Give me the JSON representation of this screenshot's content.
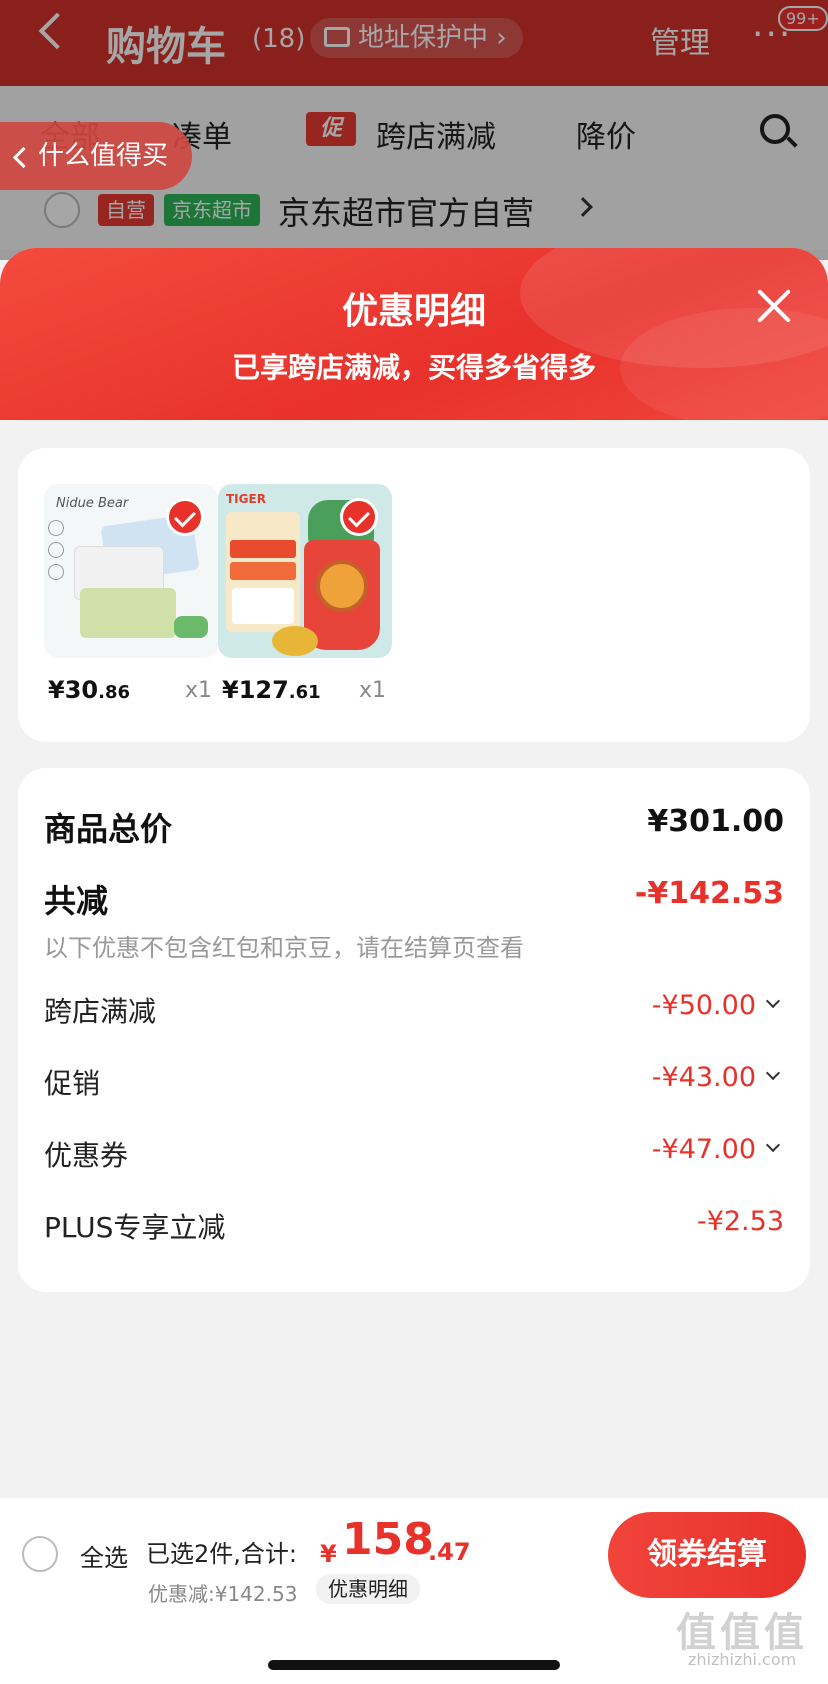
{
  "cart": {
    "title": "购物车",
    "count": "(18)",
    "address_protect": "地址保护中 ›",
    "manage": "管理",
    "more": "···",
    "badge": "99+",
    "tabs": [
      "全部",
      "凑单",
      "跨店满减",
      "降价"
    ],
    "promo_mark": "促",
    "float_tag": "什么值得买",
    "shop_tag_self": "自营",
    "shop_tag_market": "京东超市",
    "shop_name": "京东超市官方自营"
  },
  "sheet": {
    "title": "优惠明细",
    "subtitle": "已享跨店满减，买得多省得多"
  },
  "products": [
    {
      "brand": "Nidue Bear",
      "price_int": "¥30",
      "price_dec": ".86",
      "qty": "x1",
      "selected": true
    },
    {
      "brand": "TIGER",
      "price_int": "¥127",
      "price_dec": ".61",
      "qty": "x1",
      "selected": true
    }
  ],
  "summary": {
    "total_label": "商品总价",
    "total_value": "¥301.00",
    "less_label": "共减",
    "less_value": "-¥142.53",
    "note": "以下优惠不包含红包和京豆，请在结算页查看",
    "items": [
      {
        "label": "跨店满减",
        "value": "-¥50.00"
      },
      {
        "label": "促销",
        "value": "-¥43.00"
      },
      {
        "label": "优惠券",
        "value": "-¥47.00"
      },
      {
        "label": "PLUS专享立减",
        "value": "-¥2.53"
      }
    ]
  },
  "bottom": {
    "select_all": "全选",
    "selected_count": "已选2件,合计:",
    "yen": "¥",
    "total_int": "158",
    "total_dec": ".47",
    "discount": "优惠减:¥142.53",
    "detail_chip": "优惠明细",
    "pay_button": "领券结算"
  },
  "watermark": {
    "text": "值值值",
    "url": "zhizhizhi.com"
  },
  "colors": {
    "accent": "#e8312b",
    "header_bg": "#d4322c"
  }
}
